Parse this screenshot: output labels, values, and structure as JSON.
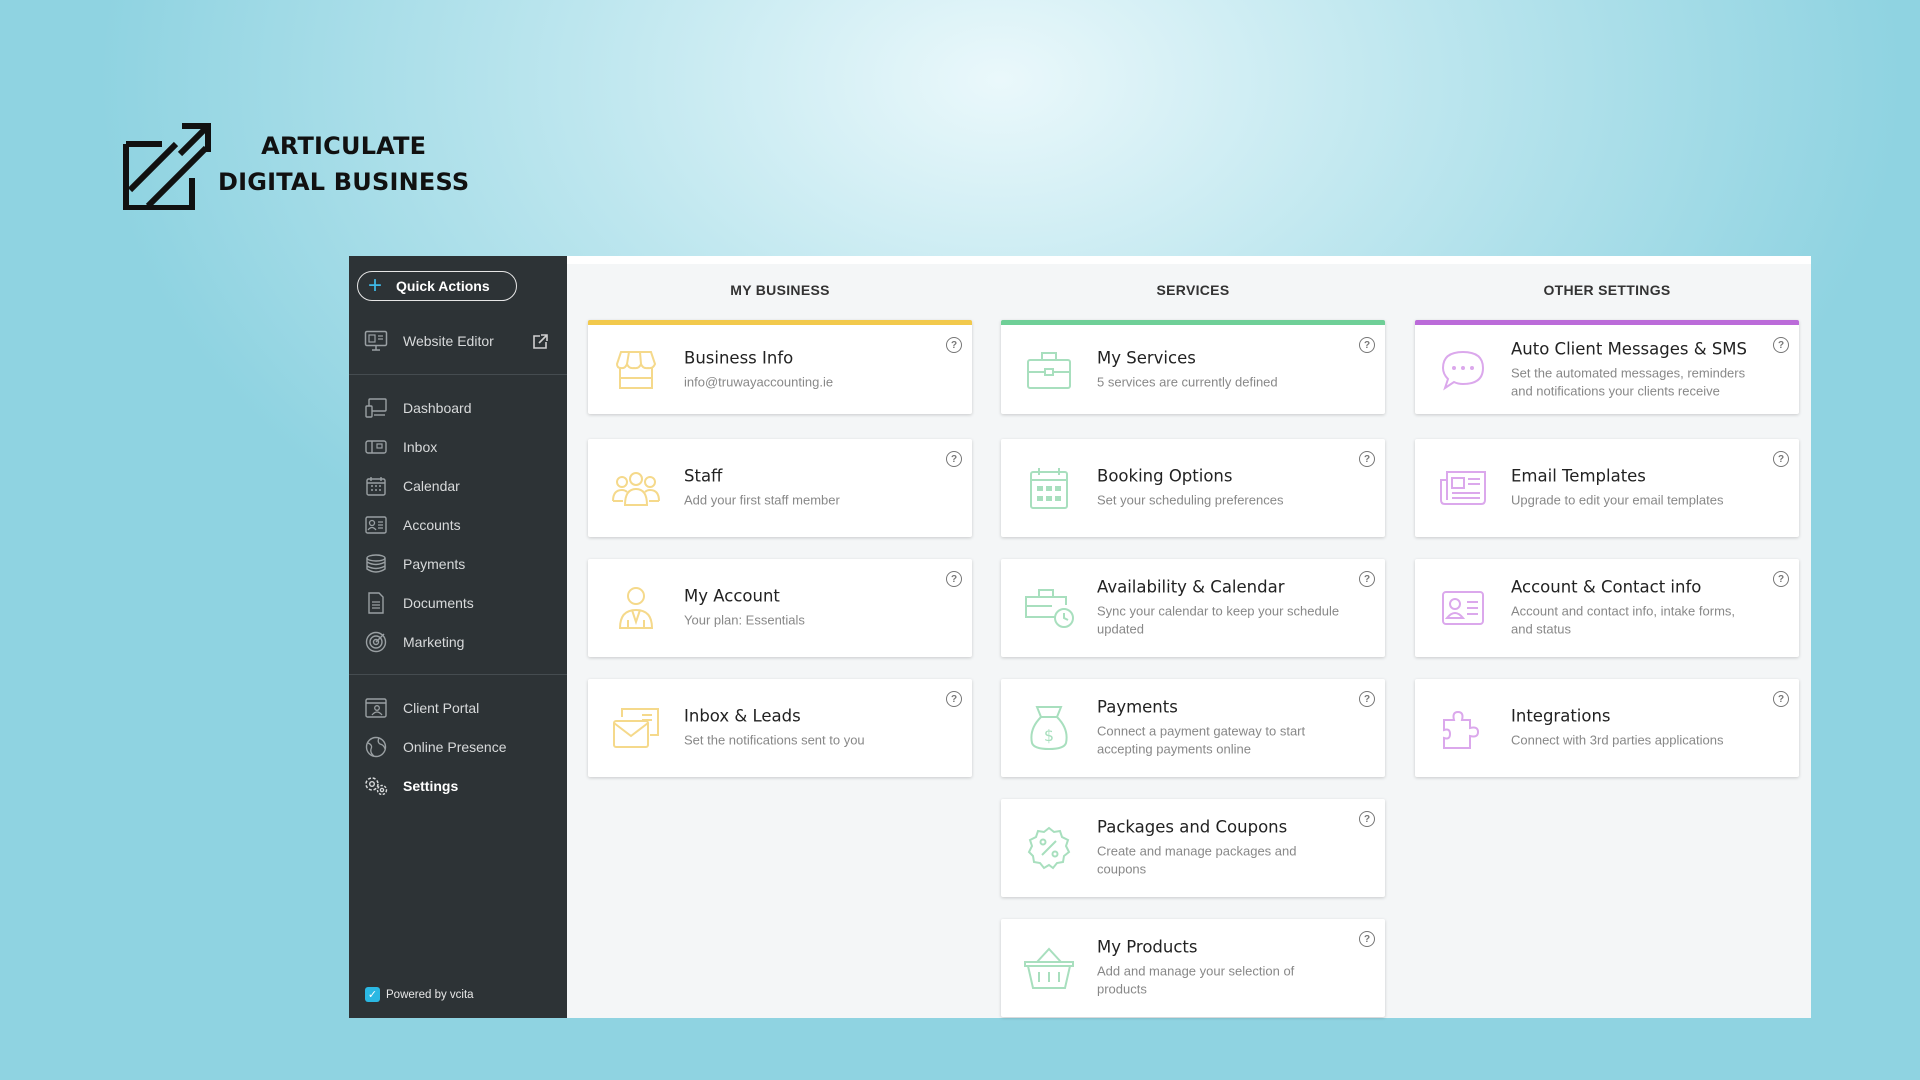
{
  "brand": {
    "line1": "ARTICULATE",
    "line2": "DIGITAL BUSINESS"
  },
  "sidebar": {
    "quick_actions": "Quick Actions",
    "website_editor": "Website Editor",
    "items": [
      {
        "label": "Dashboard",
        "icon": "dashboard-icon"
      },
      {
        "label": "Inbox",
        "icon": "inbox-icon"
      },
      {
        "label": "Calendar",
        "icon": "calendar-icon"
      },
      {
        "label": "Accounts",
        "icon": "accounts-icon"
      },
      {
        "label": "Payments",
        "icon": "payments-icon"
      },
      {
        "label": "Documents",
        "icon": "documents-icon"
      },
      {
        "label": "Marketing",
        "icon": "marketing-icon"
      }
    ],
    "bottom_items": [
      {
        "label": "Client Portal",
        "icon": "client-portal-icon"
      },
      {
        "label": "Online Presence",
        "icon": "online-presence-icon"
      },
      {
        "label": "Settings",
        "icon": "settings-icon",
        "active": true
      }
    ],
    "powered_by": "Powered by vcita"
  },
  "columns": [
    {
      "title": "MY BUSINESS",
      "accent": "#f2c94c",
      "icon_color": "#f5d98b",
      "cards": [
        {
          "title": "Business Info",
          "subtitle": "info@truwayaccounting.ie",
          "icon": "storefront-icon"
        },
        {
          "title": "Staff",
          "subtitle": "Add your first staff member",
          "icon": "staff-icon"
        },
        {
          "title": "My Account",
          "subtitle": "Your plan: Essentials",
          "icon": "account-icon"
        },
        {
          "title": "Inbox & Leads",
          "subtitle": "Set the notifications sent to you",
          "icon": "envelope-icon"
        }
      ]
    },
    {
      "title": "SERVICES",
      "accent": "#6fcf97",
      "icon_color": "#a8dfbe",
      "cards": [
        {
          "title": "My Services",
          "subtitle": "5 services are currently defined",
          "icon": "briefcase-icon"
        },
        {
          "title": "Booking Options",
          "subtitle": "Set your scheduling preferences",
          "icon": "calendar-grid-icon"
        },
        {
          "title": "Availability & Calendar",
          "subtitle": "Sync your calendar to keep your schedule updated",
          "icon": "briefcase-clock-icon"
        },
        {
          "title": "Payments",
          "subtitle": "Connect a payment gateway to start accepting payments online",
          "icon": "money-bag-icon"
        },
        {
          "title": "Packages and Coupons",
          "subtitle": "Create and manage packages and coupons",
          "icon": "percent-badge-icon"
        },
        {
          "title": "My Products",
          "subtitle": "Add and manage your selection of products",
          "icon": "basket-icon"
        }
      ]
    },
    {
      "title": "OTHER SETTINGS",
      "accent": "#bb6bd9",
      "icon_color": "#dba8ec",
      "cards": [
        {
          "title": "Auto Client Messages & SMS",
          "subtitle": "Set the automated messages, reminders and notifications your clients receive",
          "icon": "chat-bubble-icon"
        },
        {
          "title": "Email Templates",
          "subtitle": "Upgrade to edit your email templates",
          "icon": "newspaper-icon"
        },
        {
          "title": "Account & Contact info",
          "subtitle": "Account and contact info, intake forms, and status",
          "icon": "contact-card-icon"
        },
        {
          "title": "Integrations",
          "subtitle": "Connect with 3rd parties applications",
          "icon": "puzzle-icon"
        }
      ]
    }
  ],
  "help_glyph": "?"
}
